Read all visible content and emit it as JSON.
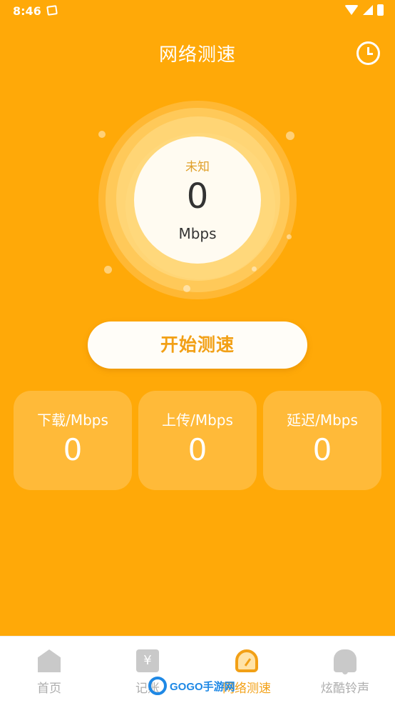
{
  "status_bar": {
    "time": "8:46"
  },
  "header": {
    "title": "网络测速"
  },
  "gauge": {
    "status": "未知",
    "value": "0",
    "unit": "Mbps"
  },
  "start_button": {
    "label": "开始测速"
  },
  "stats": [
    {
      "label": "下载/Mbps",
      "value": "0"
    },
    {
      "label": "上传/Mbps",
      "value": "0"
    },
    {
      "label": "延迟/Mbps",
      "value": "0"
    }
  ],
  "bottom_nav": {
    "items": [
      {
        "label": "首页",
        "icon": "home-icon",
        "active": false
      },
      {
        "label": "记账",
        "icon": "ledger-icon",
        "active": false
      },
      {
        "label": "网络测速",
        "icon": "speedometer-icon",
        "active": true
      },
      {
        "label": "炫酷铃声",
        "icon": "bell-icon",
        "active": false
      }
    ]
  },
  "watermark": {
    "text": "GOGO手游网"
  },
  "colors": {
    "background": "#FFA908",
    "accent": "#F2A016",
    "inactive": "#ADADAD"
  }
}
